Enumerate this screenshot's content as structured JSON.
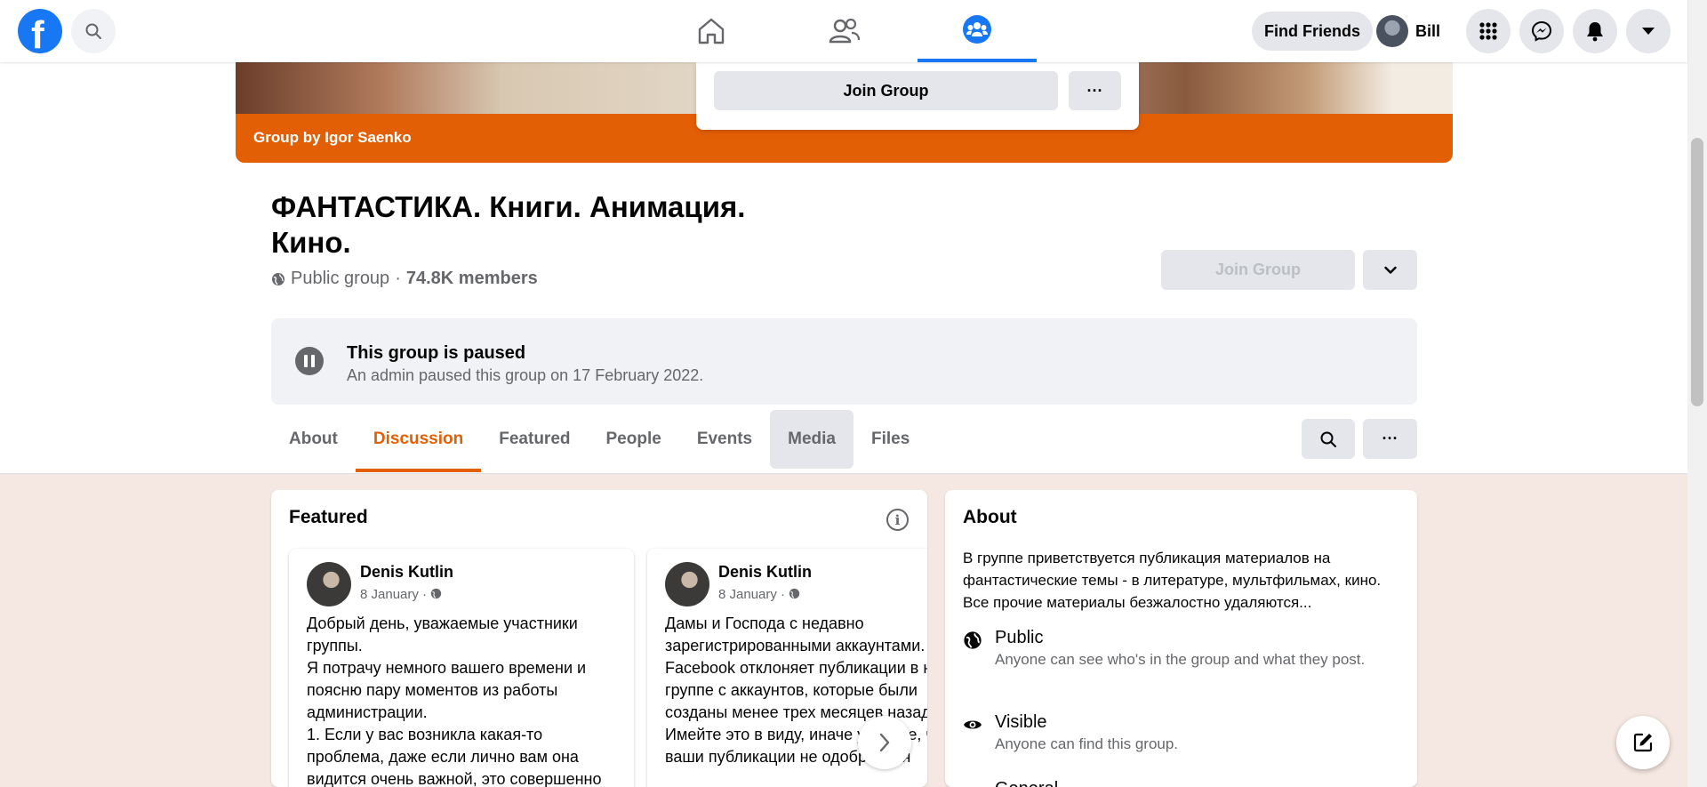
{
  "topbar": {
    "logo_letter": "f",
    "find_friends": "Find Friends",
    "user_name": "Bill"
  },
  "cover": {
    "group_by": "Group by Igor Saenko"
  },
  "join_popup": {
    "join_label": "Join Group",
    "more_label": "···"
  },
  "group": {
    "title": "ФАНТАСТИКА. Книги. Анимация. Кино.",
    "privacy": "Public group",
    "separator": "·",
    "members": "74.8K members",
    "join_label": "Join Group"
  },
  "paused": {
    "title": "This group is paused",
    "subtitle": "An admin paused this group on 17 February 2022."
  },
  "tabs": [
    {
      "label": "About"
    },
    {
      "label": "Discussion"
    },
    {
      "label": "Featured"
    },
    {
      "label": "People"
    },
    {
      "label": "Events"
    },
    {
      "label": "Media"
    },
    {
      "label": "Files"
    }
  ],
  "tab_more_label": "···",
  "featured": {
    "heading": "Featured",
    "info_glyph": "i",
    "posts": [
      {
        "author": "Denis Kutlin",
        "date": "8 January · ",
        "body": "Добрый день, уважаемые участники группы.\nЯ потрачу немного вашего времени и поясню пару моментов из работы администрации.\n1. Если у вас возникла какая-то проблема, даже если лично вам она видится очень важной, это совершенно"
      },
      {
        "author": "Denis Kutlin",
        "date": "8 January · ",
        "body": "Дамы и Господа с недавно зарегистрированными аккаунтами. Facebook отклоняет публикации в нашей группе с аккаунтов, которые были созданы менее трех месяцев назад. Имейте это в виду, иначе увидите, что ваши публикации не одобряются"
      }
    ]
  },
  "about": {
    "heading": "About",
    "description": "В группе приветствуется публикация материалов на фантастические темы - в литературе, мультфильмах, кино. Все прочие материалы безжалостно удаляются...",
    "public_title": "Public",
    "public_sub": "Anyone can see who's in the group and what they post.",
    "visible_title": "Visible",
    "visible_sub": "Anyone can find this group.",
    "general_title": "General"
  },
  "colors": {
    "brand_blue": "#1877f2",
    "group_accent": "#e35f05",
    "lower_bg": "#f5e7e1"
  },
  "icons": [
    "facebook-logo",
    "search-icon",
    "home-icon",
    "friends-icon",
    "groups-icon",
    "menu-grid-icon",
    "messenger-icon",
    "bell-icon",
    "caret-down-icon",
    "globe-icon",
    "pause-icon",
    "info-icon",
    "chevron-right-icon",
    "eye-icon",
    "compose-icon"
  ]
}
